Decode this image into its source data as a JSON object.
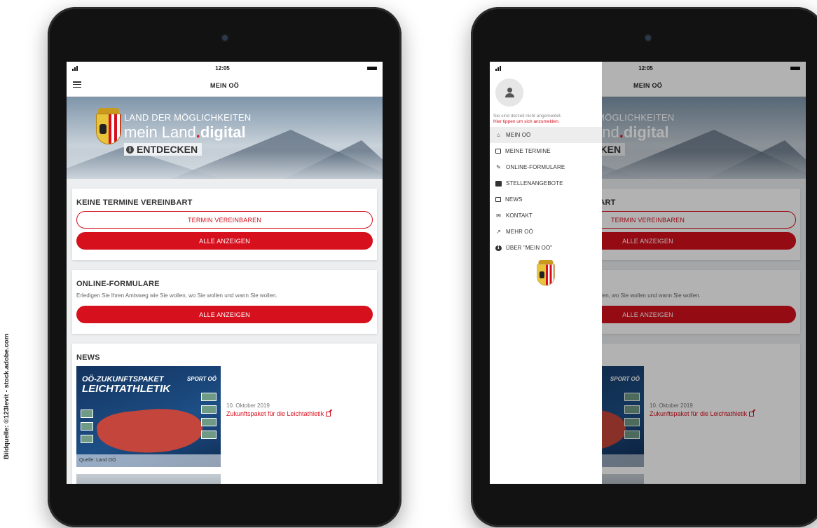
{
  "credit": "Bildquelle: ©123levit - stock.adobe.com",
  "status": {
    "time": "12:05"
  },
  "navbar": {
    "title": "MEIN OÖ"
  },
  "hero": {
    "line1": "LAND DER MÖGLICHKEITEN",
    "line2_prefix": "mein Land",
    "line2_dot": ".",
    "line2_bold": "digital",
    "line3": "ENTDECKEN"
  },
  "cards": {
    "termine": {
      "title": "KEINE TERMINE VEREINBART",
      "button_outline": "TERMIN VEREINBAREN",
      "button_solid": "ALLE ANZEIGEN"
    },
    "formulare": {
      "title": "ONLINE-FORMULARE",
      "text": "Erledigen Sie Ihren Amtsweg wie Sie wollen, wo Sie wollen und wann Sie wollen.",
      "button_solid": "ALLE ANZEIGEN"
    },
    "news": {
      "title": "NEWS",
      "thumb_title_1": "OÖ-ZUKUNFTSPAKET",
      "thumb_title_2": "LEICHTATHLETIK",
      "thumb_brand": "SPORT OÖ",
      "thumb_source": "Quelle: Land OÖ",
      "date": "10. Oktober 2019",
      "link": "Zukunftspaket für die Leichtathletik"
    }
  },
  "drawer": {
    "login_line1": "Sie sind derzeit nicht angemeldet.",
    "login_line2": "Hier tippen um sich anzumelden.",
    "items": [
      {
        "label": "MEIN OÖ",
        "icon": "home-icon",
        "glyph": "⌂"
      },
      {
        "label": "MEINE TERMINE",
        "icon": "calendar-icon",
        "glyph": ""
      },
      {
        "label": "ONLINE-FORMULARE",
        "icon": "edit-icon",
        "glyph": "✎"
      },
      {
        "label": "STELLENANGEBOTE",
        "icon": "id-card-icon",
        "glyph": ""
      },
      {
        "label": "NEWS",
        "icon": "newspaper-icon",
        "glyph": ""
      },
      {
        "label": "KONTAKT",
        "icon": "envelope-icon",
        "glyph": "✉"
      },
      {
        "label": "MEHR OÖ",
        "icon": "external-link-icon",
        "glyph": "↗"
      },
      {
        "label": "ÜBER \"MEIN OÖ\"",
        "icon": "info-icon",
        "glyph": "i"
      }
    ]
  },
  "colors": {
    "accent": "#d6101d",
    "background": "#eceef0"
  }
}
